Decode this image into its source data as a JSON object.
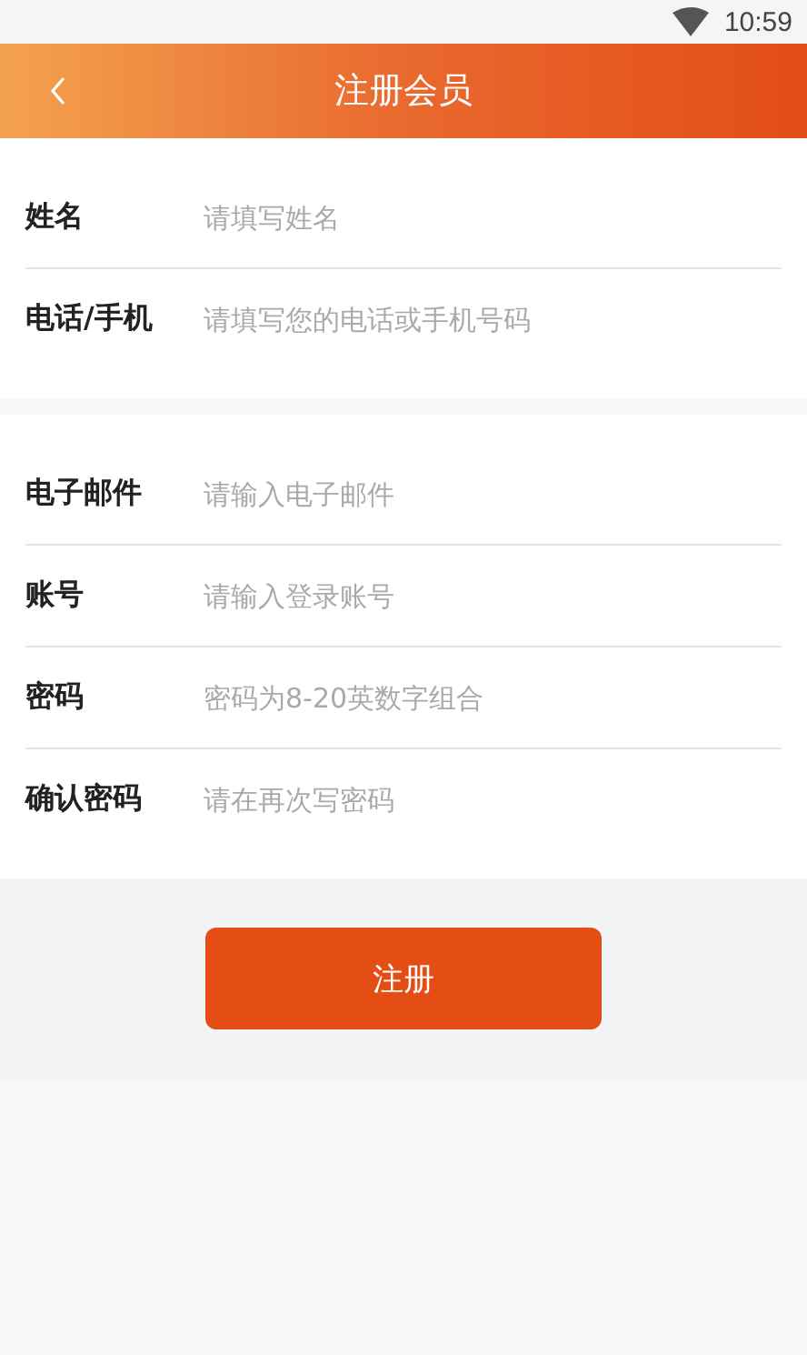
{
  "status_bar": {
    "time": "10:59"
  },
  "header": {
    "title": "注册会员"
  },
  "sections": [
    {
      "fields": [
        {
          "label": "姓名",
          "placeholder": "请填写姓名"
        },
        {
          "label": "电话/手机",
          "placeholder": "请填写您的电话或手机号码"
        }
      ]
    },
    {
      "fields": [
        {
          "label": "电子邮件",
          "placeholder": "请输入电子邮件"
        },
        {
          "label": "账号",
          "placeholder": "请输入登录账号"
        },
        {
          "label": "密码",
          "placeholder": "密码为8-20英数字组合"
        },
        {
          "label": "确认密码",
          "placeholder": "请在再次写密码"
        }
      ]
    }
  ],
  "submit_button": {
    "label": "注册"
  }
}
